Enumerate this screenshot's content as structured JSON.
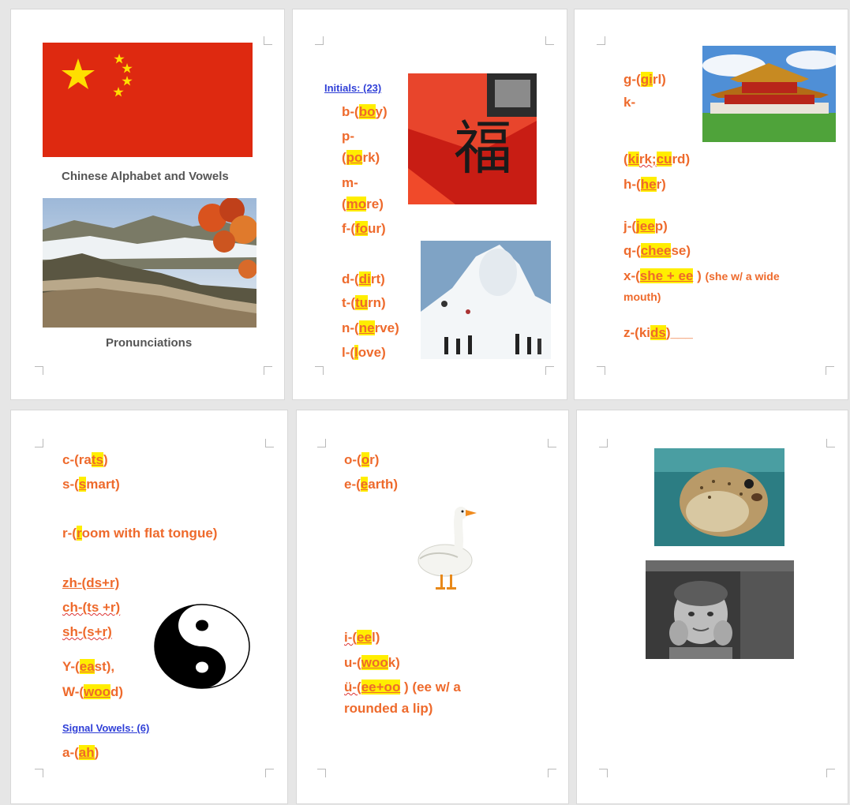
{
  "page1": {
    "title": "Chinese Alphabet and Vowels",
    "subtitle": "Pronunciations"
  },
  "page2": {
    "heading": "Initials: (23)",
    "b": {
      "pre": "b-(",
      "hl": "bo",
      "post": "y)"
    },
    "p1": "p-",
    "p2": {
      "pre": "(",
      "hl": "po",
      "post": "rk)"
    },
    "m1": "m-",
    "m2": {
      "pre": "(",
      "hl": "mo",
      "post": "re)"
    },
    "f": {
      "pre": "f-(",
      "hl": "fo",
      "post": "ur)"
    },
    "d": {
      "pre": "d-(",
      "hl": "di",
      "post": "rt)"
    },
    "t": {
      "pre": "t-(",
      "hl": "tu",
      "post": "rn)"
    },
    "n": {
      "pre": "n-(",
      "hl": "ne",
      "post": "rve)"
    },
    "l": {
      "pre": "l-(",
      "hl": "l",
      "post": "ove)"
    }
  },
  "page3": {
    "g": {
      "pre": "g-(",
      "hl": "gi",
      "post": "rl)"
    },
    "k1": "k-",
    "k2": {
      "pre": "(",
      "hl1": "ki",
      "mid": "rk;",
      "hl2": "cu",
      "post": "rd)"
    },
    "h": {
      "pre": "h-(",
      "hl": "he",
      "post": "r)"
    },
    "j": {
      "pre": "j-(",
      "hl": "jee",
      "post": "p)"
    },
    "q": {
      "pre": "q-(",
      "hl": "chee",
      "post": "se)"
    },
    "x": {
      "pre": "x-(",
      "hl": "she + ee",
      "post": " )",
      "note": "(she w/ a wide",
      "note2": "mouth)"
    },
    "z": {
      "pre": "z-(ki",
      "hl": "ds",
      "post": ")___"
    }
  },
  "page4": {
    "c": {
      "pre": "c-(ra",
      "hl": "ts",
      "post": ")"
    },
    "s": {
      "pre": "s-(",
      "hl": "s",
      "post": "mart)"
    },
    "r": {
      "pre": "r-(",
      "hl": "r",
      "post": "oom with flat tongue)"
    },
    "zh": "zh-(ds+r)",
    "ch": "ch-(ts +r)",
    "sh": "sh-(s+r)",
    "y": {
      "pre": "Y-(",
      "hl": "ea",
      "post": "st),"
    },
    "w": {
      "pre": "W-(",
      "hl": "woo",
      "post": "d)"
    },
    "heading": "Signal Vowels: (6)",
    "a": {
      "pre": "a-(",
      "hl": "ah",
      "post": ")"
    }
  },
  "page5": {
    "o": {
      "pre": "o-(",
      "hl": "o",
      "post": "r)"
    },
    "e": {
      "pre": "e-(",
      "hl": "e",
      "post": "arth)"
    },
    "i": {
      "pre": "i-(",
      "hl": "ee",
      "post": "l)"
    },
    "u": {
      "pre": "u-(",
      "hl": "woo",
      "post": "k)"
    },
    "v": {
      "pre": "ü-(",
      "hl": "ee+oo",
      "post": " ) (ee w/ a",
      "line2": "rounded a lip)"
    }
  },
  "colors": {
    "text": "#ee6a2c",
    "highlight": "#ffee00",
    "link": "#2f3fd7"
  }
}
